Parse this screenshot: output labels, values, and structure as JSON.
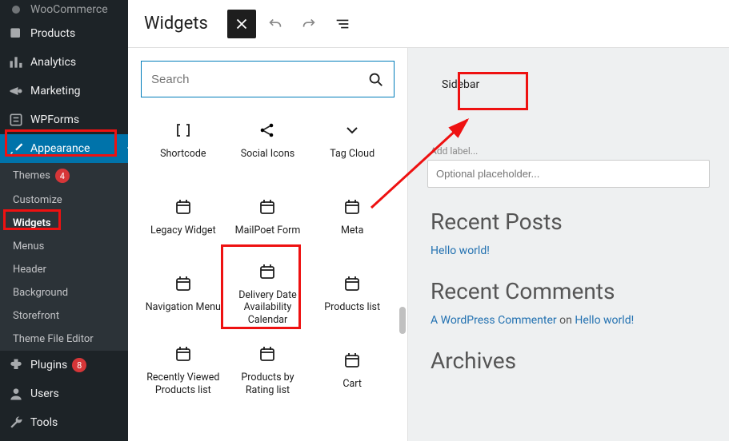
{
  "header": {
    "title": "Widgets"
  },
  "search": {
    "placeholder": "Search"
  },
  "adminMenu": {
    "items": [
      {
        "icon": "woo",
        "label": "WooCommerce"
      },
      {
        "icon": "tag",
        "label": "Products"
      },
      {
        "icon": "bar",
        "label": "Analytics"
      },
      {
        "icon": "mega",
        "label": "Marketing"
      },
      {
        "icon": "form",
        "label": "WPForms"
      },
      {
        "icon": "brush",
        "label": "Appearance",
        "active": true
      },
      {
        "icon": "plug",
        "label": "Plugins",
        "badge": "8"
      },
      {
        "icon": "user",
        "label": "Users"
      },
      {
        "icon": "wrench",
        "label": "Tools"
      }
    ],
    "appearanceSub": [
      {
        "label": "Themes",
        "badge": "4"
      },
      {
        "label": "Customize"
      },
      {
        "label": "Widgets",
        "current": true
      },
      {
        "label": "Menus"
      },
      {
        "label": "Header"
      },
      {
        "label": "Background"
      },
      {
        "label": "Storefront"
      },
      {
        "label": "Theme File Editor"
      }
    ]
  },
  "blocks": [
    {
      "icon": "shortcode",
      "label": "Shortcode"
    },
    {
      "icon": "social",
      "label": "Social Icons"
    },
    {
      "icon": "tagcloud",
      "label": "Tag Cloud"
    },
    {
      "icon": "cal",
      "label": "Legacy Widget"
    },
    {
      "icon": "cal",
      "label": "MailPoet Form"
    },
    {
      "icon": "cal",
      "label": "Meta"
    },
    {
      "icon": "cal",
      "label": "Navigation Menu"
    },
    {
      "icon": "cal",
      "label": "Delivery Date Availability Calendar"
    },
    {
      "icon": "cal",
      "label": "Products list"
    },
    {
      "icon": "cal",
      "label": "Recently Viewed Products list"
    },
    {
      "icon": "cal",
      "label": "Products by Rating list"
    },
    {
      "icon": "cal",
      "label": "Cart"
    }
  ],
  "sidebarPanel": {
    "tab": "Sidebar",
    "addLabel": "Add label...",
    "placeholder": "Optional placeholder...",
    "recentPostsHeading": "Recent Posts",
    "recentPost": "Hello world!",
    "recentCommentsHeading": "Recent Comments",
    "commentAuthor": "A WordPress Commenter",
    "commentOn": "on",
    "commentPost": "Hello world!",
    "archivesHeading": "Archives"
  }
}
